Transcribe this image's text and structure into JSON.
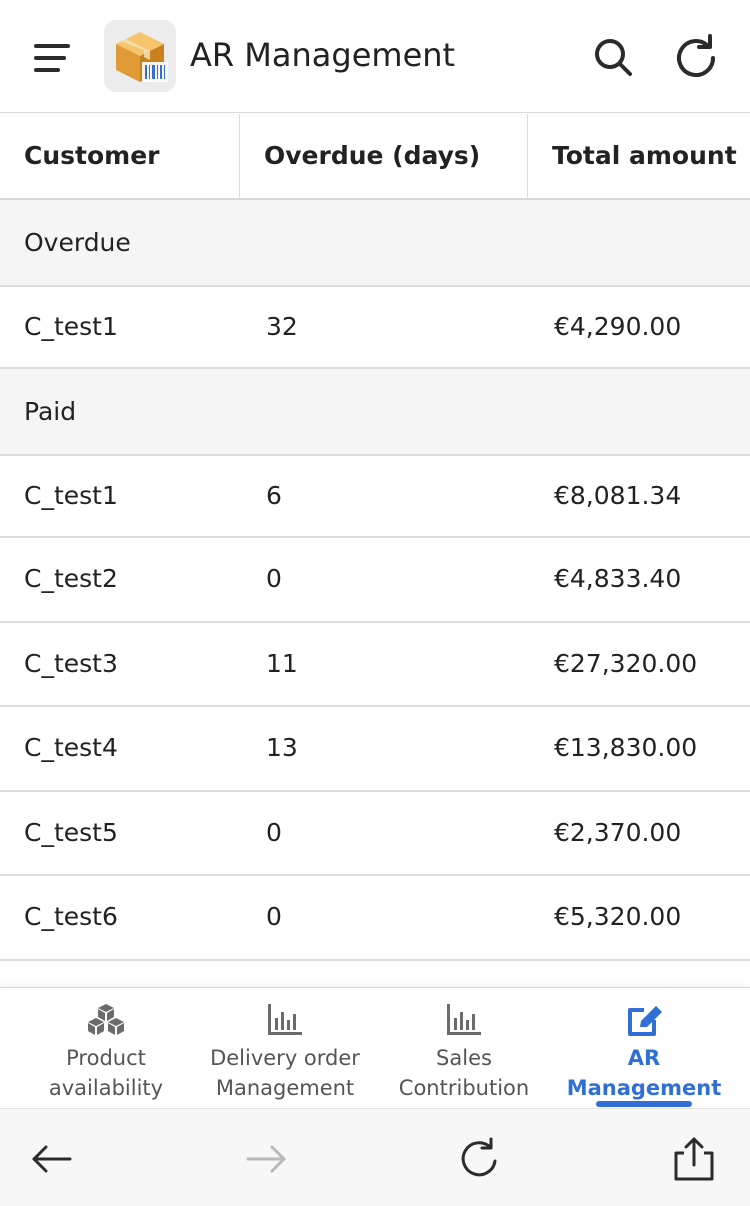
{
  "header": {
    "title": "AR Management",
    "menu_icon": "hamburger-menu-icon",
    "app_icon": "package-barcode-icon",
    "search_icon": "search-icon",
    "refresh_icon": "refresh-icon"
  },
  "table": {
    "columns": [
      "Customer",
      "Overdue (days)",
      "Total amount"
    ],
    "groups": [
      {
        "label": "Overdue",
        "rows": [
          {
            "customer": "C_test1",
            "overdue_days": "32",
            "total": "€4,290.00"
          }
        ]
      },
      {
        "label": "Paid",
        "rows": [
          {
            "customer": "C_test1",
            "overdue_days": "6",
            "total": "€8,081.34"
          },
          {
            "customer": "C_test2",
            "overdue_days": "0",
            "total": "€4,833.40"
          },
          {
            "customer": "C_test3",
            "overdue_days": "11",
            "total": "€27,320.00"
          },
          {
            "customer": "C_test4",
            "overdue_days": "13",
            "total": "€13,830.00"
          },
          {
            "customer": "C_test5",
            "overdue_days": "0",
            "total": "€2,370.00"
          },
          {
            "customer": "C_test6",
            "overdue_days": "0",
            "total": "€5,320.00"
          }
        ]
      }
    ]
  },
  "tabs": [
    {
      "label_line1": "Product",
      "label_line2": "availability",
      "icon": "cubes-icon",
      "active": false
    },
    {
      "label_line1": "Delivery order",
      "label_line2": "Management",
      "icon": "bar-chart-icon",
      "active": false
    },
    {
      "label_line1": "Sales",
      "label_line2": "Contribution",
      "icon": "bar-chart-icon",
      "active": false
    },
    {
      "label_line1": "AR",
      "label_line2": "Management",
      "icon": "edit-icon",
      "active": true
    }
  ],
  "browser_bar": {
    "back_icon": "arrow-left-icon",
    "forward_icon": "arrow-right-icon",
    "reload_icon": "reload-icon",
    "share_icon": "share-icon"
  },
  "colors": {
    "accent": "#2f6fd6",
    "group_row_bg": "#f5f5f5",
    "divider": "#dddddd"
  }
}
